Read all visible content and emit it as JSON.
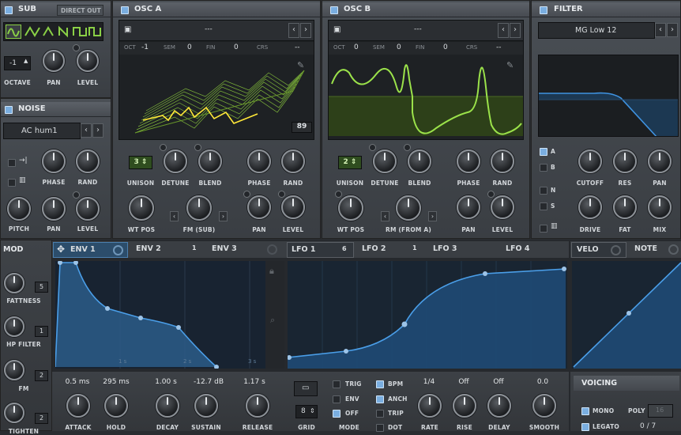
{
  "colors": {
    "accent": "#7aaee0",
    "wave_green": "#9be24a",
    "env_blue": "#3d86c8",
    "curve": "#4a9ee8"
  },
  "sub": {
    "title": "SUB",
    "direct_out": "DIRECT OUT",
    "octave_value": "-1",
    "knobs": [
      "OCTAVE",
      "PAN",
      "LEVEL"
    ]
  },
  "noise": {
    "title": "NOISE",
    "preset": "AC hum1",
    "knobs": [
      "PHASE",
      "RAND",
      "PITCH",
      "PAN",
      "LEVEL"
    ]
  },
  "osc_a": {
    "title": "OSC A",
    "wavetable_name": "---",
    "oct_label": "OCT",
    "oct": "-1",
    "sem_label": "SEM",
    "sem": "0",
    "fin_label": "FIN",
    "fin": "0",
    "crs_label": "CRS",
    "crs": "--",
    "frame": "89",
    "unison": "3",
    "knobs_top": [
      "UNISON",
      "DETUNE",
      "BLEND",
      "PHASE",
      "RAND"
    ],
    "knobs_bottom": [
      "WT POS",
      "FM (SUB)",
      "PAN",
      "LEVEL"
    ]
  },
  "osc_b": {
    "title": "OSC B",
    "wavetable_name": "---",
    "oct_label": "OCT",
    "oct": "0",
    "sem_label": "SEM",
    "sem": "0",
    "fin_label": "FIN",
    "fin": "0",
    "crs_label": "CRS",
    "crs": "--",
    "unison": "2",
    "knobs_top": [
      "UNISON",
      "DETUNE",
      "BLEND",
      "PHASE",
      "RAND"
    ],
    "knobs_bottom": [
      "WT POS",
      "RM (FROM A)",
      "PAN",
      "LEVEL"
    ]
  },
  "filter": {
    "title": "FILTER",
    "type": "MG Low 12",
    "route_a": "A",
    "route_b": "B",
    "route_n": "N",
    "route_s": "S",
    "knobs": [
      "CUTOFF",
      "RES",
      "PAN",
      "DRIVE",
      "FAT",
      "MIX"
    ]
  },
  "mod": {
    "title": "MOD",
    "tabs": [
      {
        "label": "ENV 1"
      },
      {
        "label": "ENV 2",
        "count": "1"
      },
      {
        "label": "ENV 3"
      }
    ],
    "lfo_tabs": [
      {
        "label": "LFO 1",
        "count": "6"
      },
      {
        "label": "LFO 2",
        "count": "1"
      },
      {
        "label": "LFO 3"
      },
      {
        "label": "LFO 4"
      }
    ],
    "velo": "VELO",
    "note": "NOTE"
  },
  "mod_sources": [
    {
      "label": "FATTNESS",
      "count": "5"
    },
    {
      "label": "HP FILTER",
      "count": "1"
    },
    {
      "label": "FM",
      "count": "2"
    },
    {
      "label": "TIGHTEN",
      "count": "2"
    }
  ],
  "env": {
    "values": [
      "0.5 ms",
      "295 ms",
      "1.00 s",
      "-12.7 dB",
      "1.17 s"
    ],
    "labels": [
      "ATTACK",
      "HOLD",
      "DECAY",
      "SUSTAIN",
      "RELEASE"
    ],
    "markers": [
      "1 s",
      "2 s",
      "3 s"
    ]
  },
  "lfo": {
    "grid_label": "GRID",
    "grid": "8",
    "mode_label": "MODE",
    "trig": "TRIG",
    "env": "ENV",
    "off": "OFF",
    "bpm": "BPM",
    "anch": "ANCH",
    "trip": "TRIP",
    "dot": "DOT",
    "rate": "1/4",
    "rise": "Off",
    "delay": "Off",
    "smooth": "0.0",
    "knob_labels": [
      "RATE",
      "RISE",
      "DELAY",
      "SMOOTH"
    ]
  },
  "voicing": {
    "title": "VOICING",
    "mono": "MONO",
    "poly": "POLY",
    "poly_value": "16",
    "legato": "LEGATO",
    "voices": "0 / 7"
  }
}
